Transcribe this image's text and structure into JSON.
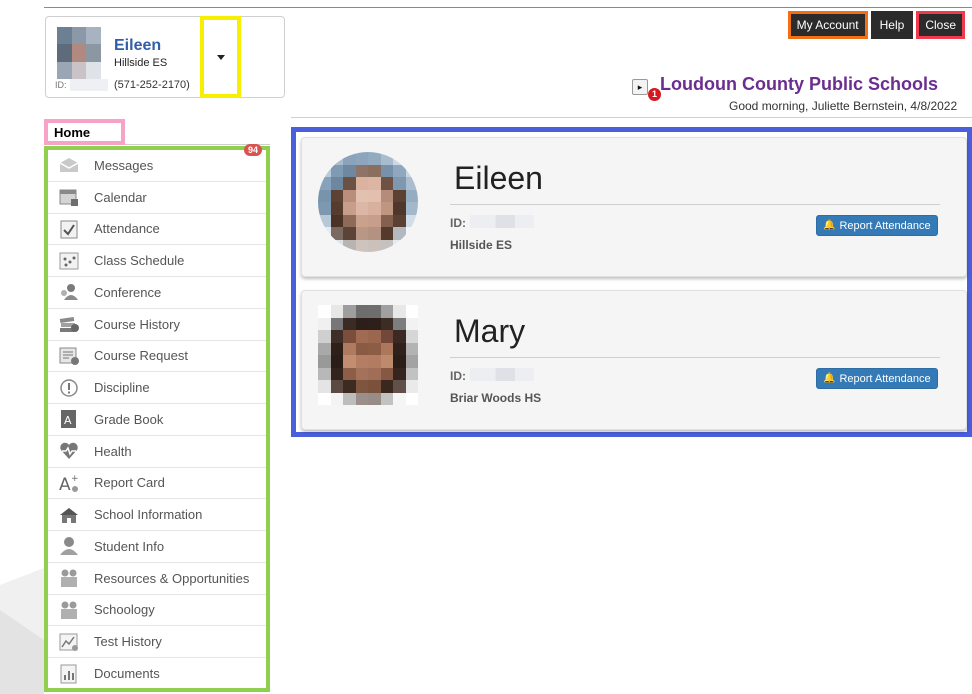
{
  "student_selector": {
    "name": "Eileen",
    "school": "Hillside ES",
    "id_label": "ID:",
    "phone": "(571-252-2170)"
  },
  "top_buttons": {
    "my_account": "My Account",
    "help": "Help",
    "close": "Close"
  },
  "header": {
    "notification_count": "1",
    "district_name": "Loudoun County Public Schools",
    "greeting": "Good morning, Juliette Bernstein, 4/8/2022"
  },
  "sidebar": {
    "home_label": "Home",
    "items": [
      {
        "label": "Messages",
        "icon": "messages-icon",
        "badge": "94"
      },
      {
        "label": "Calendar",
        "icon": "calendar-icon"
      },
      {
        "label": "Attendance",
        "icon": "attendance-icon"
      },
      {
        "label": "Class Schedule",
        "icon": "class-schedule-icon"
      },
      {
        "label": "Conference",
        "icon": "conference-icon"
      },
      {
        "label": "Course History",
        "icon": "course-history-icon"
      },
      {
        "label": "Course Request",
        "icon": "course-request-icon"
      },
      {
        "label": "Discipline",
        "icon": "discipline-icon"
      },
      {
        "label": "Grade Book",
        "icon": "grade-book-icon"
      },
      {
        "label": "Health",
        "icon": "health-icon"
      },
      {
        "label": "Report Card",
        "icon": "report-card-icon"
      },
      {
        "label": "School Information",
        "icon": "school-information-icon"
      },
      {
        "label": "Student Info",
        "icon": "student-info-icon"
      },
      {
        "label": "Resources & Opportunities",
        "icon": "resources-icon"
      },
      {
        "label": "Schoology",
        "icon": "schoology-icon"
      },
      {
        "label": "Test History",
        "icon": "test-history-icon"
      },
      {
        "label": "Documents",
        "icon": "documents-icon"
      }
    ]
  },
  "students": [
    {
      "name": "Eileen",
      "id_label": "ID:",
      "school": "Hillside ES",
      "button": "Report Attendance"
    },
    {
      "name": "Mary",
      "id_label": "ID:",
      "school": "Briar Woods HS",
      "button": "Report Attendance"
    }
  ],
  "colors": {
    "district_purple": "#6b2d8f",
    "button_blue": "#337ab7",
    "highlight_yellow": "#f6f000",
    "highlight_green": "#8fd14f",
    "highlight_blue": "#4a5fdc",
    "highlight_pink": "#f7a3c8",
    "highlight_orange": "#f07018",
    "highlight_red": "#ef3b4d"
  }
}
